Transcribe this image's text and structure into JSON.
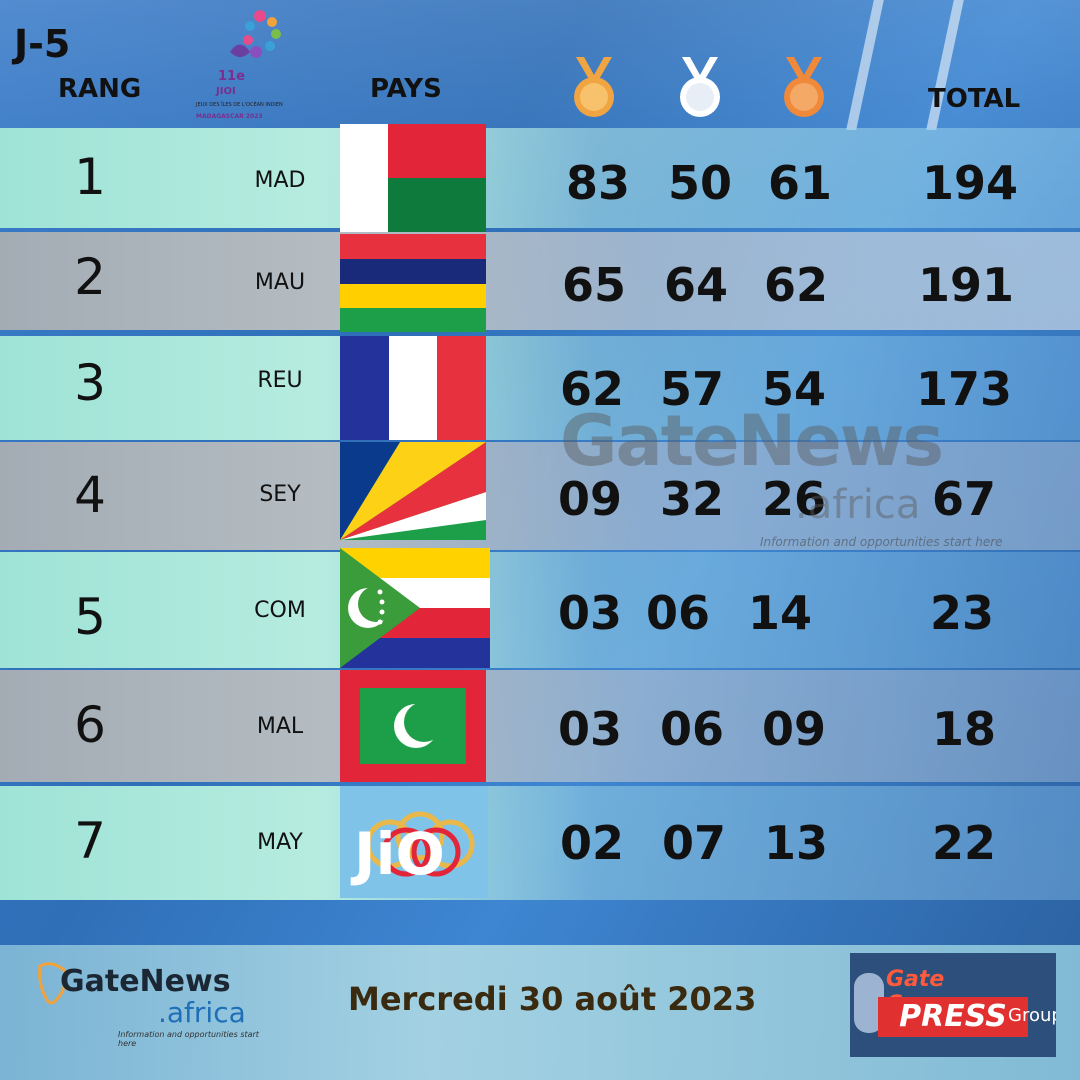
{
  "header": {
    "countdown": "J-5",
    "col_rank": "RANG",
    "col_country": "PAYS",
    "col_total": "TOTAL",
    "logo_text_games": "11e JIOI",
    "logo_text_sub": "JEUX DES ÎLES DE L'OCÉAN INDIEN",
    "logo_text_place": "MADAGASCAR 2023"
  },
  "medal_colors": {
    "gold": "#f0a542",
    "silver": "#ffffff",
    "bronze": "#f08a3a"
  },
  "rows": [
    {
      "rank": "1",
      "code": "MAD",
      "gold": "83",
      "silver": "50",
      "bronze": "61",
      "total": "194"
    },
    {
      "rank": "2",
      "code": "MAU",
      "gold": "65",
      "silver": "64",
      "bronze": "62",
      "total": "191"
    },
    {
      "rank": "3",
      "code": "REU",
      "gold": "62",
      "silver": "57",
      "bronze": "54",
      "total": "173"
    },
    {
      "rank": "4",
      "code": "SEY",
      "gold": "09",
      "silver": "32",
      "bronze": "26",
      "total": "67"
    },
    {
      "rank": "5",
      "code": "COM",
      "gold": "03",
      "silver": "06",
      "bronze": "14",
      "total": "23"
    },
    {
      "rank": "6",
      "code": "MAL",
      "gold": "03",
      "silver": "06",
      "bronze": "09",
      "total": "18"
    },
    {
      "rank": "7",
      "code": "MAY",
      "gold": "02",
      "silver": "07",
      "bronze": "13",
      "total": "22"
    }
  ],
  "watermark": {
    "brand": "GateNews",
    "domain": ".africa",
    "tagline": "Information and opportunities start here"
  },
  "footer": {
    "date": "Mercredi  30 août 2023",
    "brand_main": "GateNews",
    "brand_domain": ".africa",
    "brand_tagline": "Information and opportunities start here",
    "press_top": "Gate Company",
    "press_main": "PRESS",
    "press_group": "Group"
  }
}
